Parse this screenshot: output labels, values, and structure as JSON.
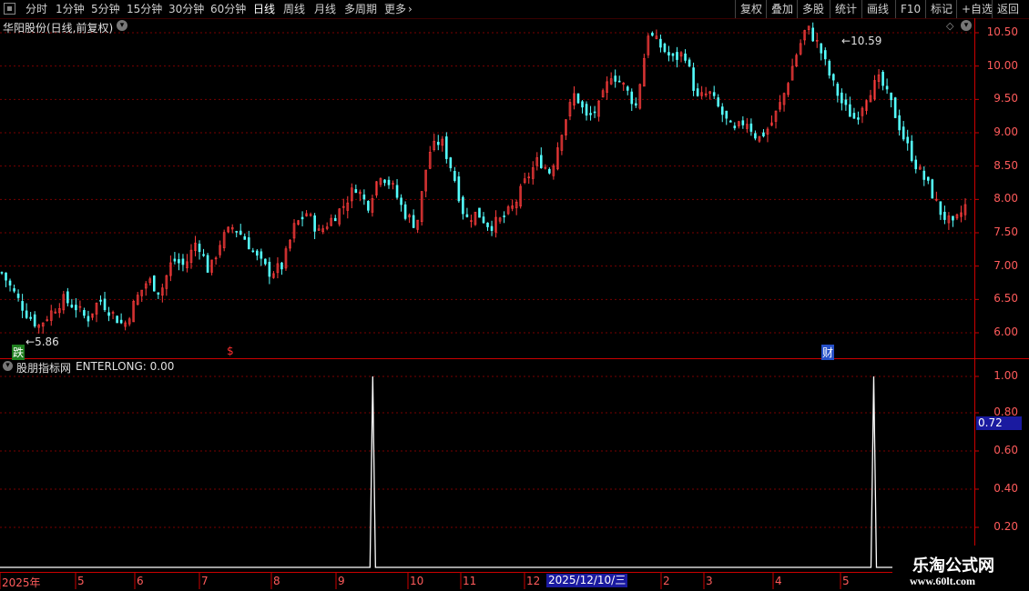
{
  "toolbar": {
    "periods": [
      "分时",
      "1分钟",
      "5分钟",
      "15分钟",
      "30分钟",
      "60分钟",
      "日线",
      "周线",
      "月线",
      "多周期",
      "更多"
    ],
    "active_period": "日线",
    "actions": [
      "复权",
      "叠加",
      "多股",
      "统计",
      "画线",
      "F10",
      "标记",
      "+自选",
      "返回"
    ]
  },
  "main_panel": {
    "title": "华阳股份(日线,前复权)",
    "y_axis_labels": [
      "10.50",
      "10.00",
      "9.50",
      "9.00",
      "8.50",
      "8.00",
      "7.50",
      "7.00",
      "6.50",
      "6.00"
    ],
    "high_label": "10.59",
    "low_label": "5.86",
    "markers": [
      {
        "text": "跌",
        "color": "#00c000"
      },
      {
        "text": "$",
        "color": "#ff3030"
      },
      {
        "text": "财",
        "color": "#3a6cff"
      }
    ]
  },
  "indicator_panel": {
    "title": "股朋指标网",
    "value_text": "ENTERLONG: 0.00",
    "y_axis_labels": [
      "1.00",
      "0.80",
      "0.60",
      "0.40",
      "0.20"
    ],
    "cursor_value": "0.72"
  },
  "date_axis": {
    "labels": [
      "2025年",
      "5",
      "6",
      "7",
      "8",
      "9",
      "10",
      "11",
      "12",
      "2",
      "3",
      "4",
      "5"
    ],
    "highlight": "2025/12/10/三"
  },
  "watermark": {
    "title": "乐淘公式网",
    "url": "www.60lt.com"
  },
  "colors": {
    "up": "#ff3c3c",
    "down": "#54ffff",
    "grid": "#7a0000",
    "axis_text": "#ff5b5b",
    "signal": "#ffffff"
  },
  "chart_data": [
    {
      "type": "candlestick",
      "title": "华阳股份(日线,前复权)",
      "ylim": [
        5.8,
        10.7
      ],
      "high": 10.59,
      "low": 5.86,
      "close_path": [
        6.9,
        6.6,
        6.3,
        6.1,
        6.3,
        6.5,
        6.4,
        6.2,
        6.5,
        6.3,
        6.1,
        6.5,
        6.8,
        6.6,
        7.1,
        7.0,
        7.4,
        6.9,
        7.4,
        7.6,
        7.4,
        7.1,
        6.9,
        7.0,
        7.6,
        7.8,
        7.5,
        7.7,
        7.9,
        8.2,
        7.9,
        8.4,
        8.2,
        7.8,
        7.6,
        8.7,
        8.9,
        8.4,
        7.7,
        7.8,
        7.6,
        7.7,
        7.9,
        8.3,
        8.6,
        8.4,
        9.1,
        9.6,
        9.2,
        9.4,
        9.9,
        9.7,
        9.4,
        10.5,
        10.3,
        10.1,
        10.2,
        9.5,
        9.6,
        9.3,
        9.0,
        9.2,
        8.9,
        9.1,
        9.5,
        10.1,
        10.59,
        10.3,
        9.8,
        9.4,
        9.2,
        9.6,
        9.8,
        9.4,
        8.9,
        8.5,
        8.2,
        7.8,
        7.6,
        7.9
      ],
      "annotations": [
        "10.59",
        "5.86"
      ]
    },
    {
      "type": "line",
      "name": "ENTERLONG",
      "ylim": [
        0,
        1.1
      ],
      "baseline": 0.0,
      "spikes": [
        {
          "position_fraction": 0.385,
          "value": 1.0
        },
        {
          "position_fraction": 0.905,
          "value": 1.0
        }
      ]
    }
  ]
}
